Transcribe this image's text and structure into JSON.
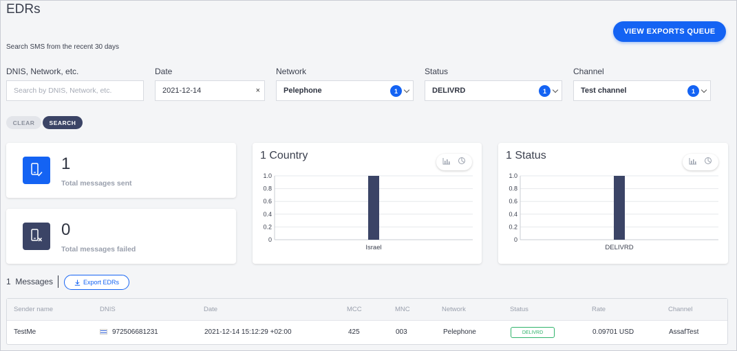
{
  "page": {
    "title": "EDRs",
    "subtitle": "Search SMS from the recent 30 days",
    "export_queue_label": "VIEW EXPORTS QUEUE"
  },
  "filters": {
    "query": {
      "label": "DNIS, Network, etc.",
      "placeholder": "Search by DNIS, Network, etc.",
      "value": ""
    },
    "date": {
      "label": "Date",
      "value": "2021-12-14",
      "clear": "×"
    },
    "network": {
      "label": "Network",
      "value": "Pelephone",
      "count": "1"
    },
    "status": {
      "label": "Status",
      "value": "DELIVRD",
      "count": "1"
    },
    "channel": {
      "label": "Channel",
      "value": "Test channel",
      "count": "1"
    }
  },
  "actions": {
    "clear_label": "CLEAR",
    "search_label": "SEARCH"
  },
  "stats": {
    "sent": {
      "value": "1",
      "label": "Total messages sent",
      "color": "#1463f3"
    },
    "failed": {
      "value": "0",
      "label": "Total messages failed",
      "color": "#3b4466"
    }
  },
  "chart_data": [
    {
      "type": "bar",
      "title": "1 Country",
      "categories": [
        "Israel"
      ],
      "values": [
        1
      ],
      "ylim": [
        0,
        1
      ],
      "yticks": [
        "1.0",
        "0.8",
        "0.6",
        "0.4",
        "0.2",
        "0"
      ],
      "grid": true,
      "bar_color": "#3b4466"
    },
    {
      "type": "bar",
      "title": "1 Status",
      "categories": [
        "DELIVRD"
      ],
      "values": [
        1
      ],
      "ylim": [
        0,
        1
      ],
      "yticks": [
        "1.0",
        "0.8",
        "0.6",
        "0.4",
        "0.2",
        "0"
      ],
      "grid": true,
      "bar_color": "#3b4466"
    }
  ],
  "messages": {
    "count": "1",
    "count_label": "Messages",
    "export_label": "Export EDRs"
  },
  "table": {
    "headers": [
      "Sender name",
      "DNIS",
      "Date",
      "MCC",
      "MNC",
      "Network",
      "Status",
      "Rate",
      "Channel"
    ],
    "rows": [
      {
        "sender": "TestMe",
        "dnis": "972506681231",
        "date": "2021-12-14 15:12:29 +02:00",
        "mcc": "425",
        "mnc": "003",
        "network": "Pelephone",
        "status": "DELIVRD",
        "rate": "0.09701 USD",
        "channel": "AssafTest"
      }
    ]
  }
}
